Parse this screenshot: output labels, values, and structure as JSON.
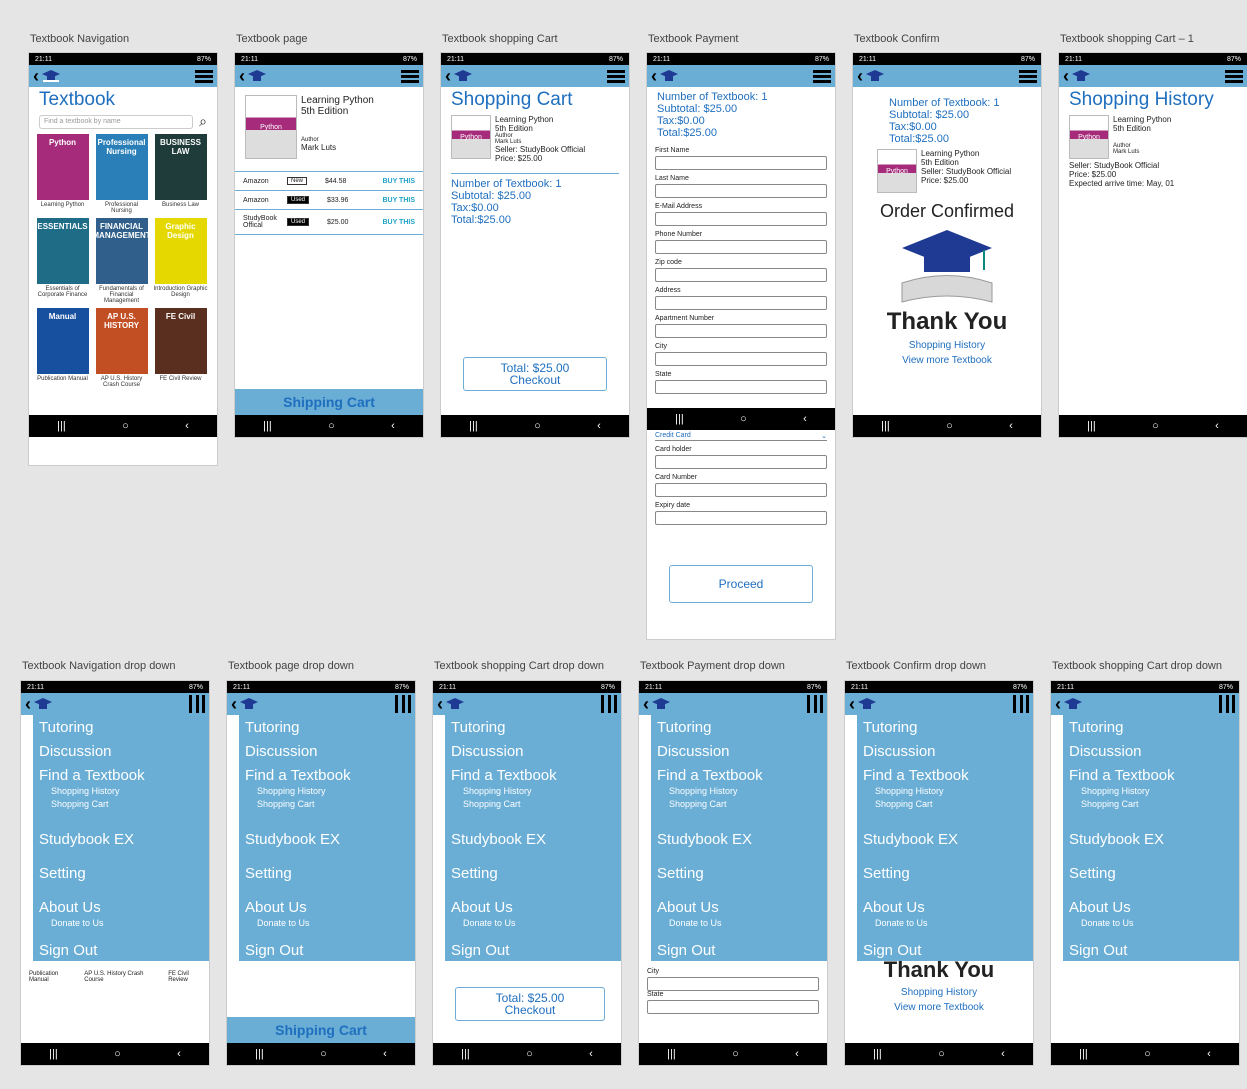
{
  "status": {
    "time": "21:11",
    "icons": "⬇ ♪",
    "right": "87%"
  },
  "frames": {
    "f1": "Textbook Navigation",
    "f2": "Textbook page",
    "f3": "Textbook shopping Cart",
    "f4": "Textbook Payment",
    "f5": "Textbook Confirm",
    "f6": "Textbook shopping Cart – 1",
    "f7": "Textbook Navigation drop down",
    "f8": "Textbook page drop down",
    "f9": "Textbook shopping Cart drop down",
    "f10": "Textbook Payment drop down",
    "f11": "Textbook Confirm drop down",
    "f12": "Textbook shopping Cart drop down"
  },
  "nav": {
    "title": "Textbook",
    "search_placeholder": "Find a textbook by name",
    "books": [
      {
        "title": "Learning Python",
        "cover": "Python",
        "color": "#a62c7b"
      },
      {
        "title": "Professional Nursing",
        "cover": "Professional Nursing",
        "color": "#2a7fb8"
      },
      {
        "title": "Business Law",
        "cover": "BUSINESS LAW",
        "color": "#1f3b3a"
      },
      {
        "title": "Essentials of Corporate Finance",
        "cover": "ESSENTIALS",
        "color": "#1e6c86"
      },
      {
        "title": "Fundamentals of Financial Management",
        "cover": "FINANCIAL MANAGEMENT",
        "color": "#2f5f8a"
      },
      {
        "title": "Introduction Graphic Design",
        "cover": "Graphic Design",
        "color": "#e4d800"
      },
      {
        "title": "Publication Manual",
        "cover": "Manual",
        "color": "#1850a0"
      },
      {
        "title": "AP U.S. History Crash Course",
        "cover": "AP U.S. HISTORY",
        "color": "#c24e24"
      },
      {
        "title": "FE Civil Review",
        "cover": "FE Civil",
        "color": "#5a2f1f"
      }
    ]
  },
  "page": {
    "title": "Learning Python",
    "edition": "5th Edition",
    "author_label": "Author",
    "author": "Mark Luts",
    "cover": "Python",
    "offers": [
      {
        "seller": "Amazon",
        "cond": "New",
        "price": "$44.58",
        "buy": "BUY THIS"
      },
      {
        "seller": "Amazon",
        "cond": "Used",
        "price": "$33.96",
        "buy": "BUY THIS"
      },
      {
        "seller": "StudyBook Offical",
        "cond": "Used",
        "price": "$25.00",
        "buy": "BUY THIS"
      }
    ],
    "shipping": "Shipping Cart"
  },
  "cart": {
    "title": "Shopping Cart",
    "book": "Learning Python",
    "edition": "5th Edition",
    "author_label": "Author",
    "author": "Mark Luts",
    "seller": "Seller: StudyBook Official",
    "price": "Price: $25.00",
    "count": "Number of Textbook: 1",
    "subtotal": "Subtotal: $25.00",
    "tax": "Tax:$0.00",
    "total": "Total:$25.00",
    "btn_total": "Total: $25.00",
    "btn_checkout": "Checkout"
  },
  "pay": {
    "fields": [
      "First Name",
      "Last Name",
      "E-Mail Address",
      "Phone Number",
      "Zip code",
      "Address",
      "Apartment Number",
      "City",
      "State"
    ],
    "card_select": "Credit Card",
    "card_fields": [
      "Card holder",
      "Card Number",
      "Expiry date"
    ],
    "proceed": "Proceed"
  },
  "confirm": {
    "heading": "Order Confirmed",
    "thanks": "Thank You",
    "history": "Shopping History",
    "more": "View more Textbook"
  },
  "history": {
    "title": "Shopping History",
    "expected": "Expected arrive time: May, 01"
  },
  "menu": {
    "tutoring": "Tutoring",
    "discussion": "Discussion",
    "find": "Find a Textbook",
    "sh": "Shopping History",
    "sc": "Shopping Cart",
    "ex": "Studybook EX",
    "setting": "Setting",
    "about": "About Us",
    "donate": "Donate to Us",
    "signout": "Sign Out"
  }
}
